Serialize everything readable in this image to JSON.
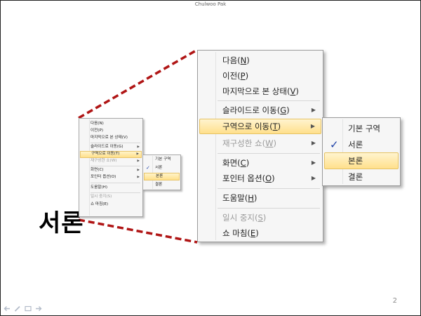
{
  "slide": {
    "title": "Chulwoo Pak",
    "page_number": "2",
    "big_label": "서론"
  },
  "colors": {
    "connector": "#b01515",
    "highlight": "#ffe08a",
    "check": "#1b3fa6"
  },
  "nav_icons": [
    "prev-arrow-icon",
    "pen-icon",
    "menu-icon",
    "next-arrow-icon"
  ],
  "menu": {
    "items": [
      {
        "label": "다음(N)",
        "disabled": false,
        "submenu": false,
        "active": false
      },
      {
        "label": "이전(P)",
        "disabled": false,
        "submenu": false,
        "active": false
      },
      {
        "label": "마지막으로 본 상태(V)",
        "disabled": false,
        "submenu": false,
        "active": false
      },
      {
        "label": "슬라이드로 이동(G)",
        "disabled": false,
        "submenu": true,
        "active": false
      },
      {
        "label": "구역으로 이동(T)",
        "disabled": false,
        "submenu": true,
        "active": true
      },
      {
        "label": "재구성한 쇼(W)",
        "disabled": true,
        "submenu": true,
        "active": false
      },
      {
        "label": "화면(C)",
        "disabled": false,
        "submenu": true,
        "active": false
      },
      {
        "label": "포인터 옵션(O)",
        "disabled": false,
        "submenu": true,
        "active": false
      },
      {
        "label": "도움말(H)",
        "disabled": false,
        "submenu": false,
        "active": false
      },
      {
        "label": "일시 중지(S)",
        "disabled": true,
        "submenu": false,
        "active": false
      },
      {
        "label": "쇼 마침(E)",
        "disabled": false,
        "submenu": false,
        "active": false
      }
    ]
  },
  "submenu": {
    "items": [
      {
        "label": "기본 구역",
        "checked": false,
        "active": false
      },
      {
        "label": "서론",
        "checked": true,
        "active": false
      },
      {
        "label": "본론",
        "checked": false,
        "active": true
      },
      {
        "label": "결론",
        "checked": false,
        "active": false
      }
    ]
  },
  "large_menu_labels": [
    {
      "text": "다음",
      "key": "N"
    },
    {
      "text": "이전",
      "key": "P"
    },
    {
      "text": "마지막으로 본 상태",
      "key": "V"
    },
    {
      "text": "슬라이드로 이동",
      "key": "G"
    },
    {
      "text": "구역으로 이동",
      "key": "T"
    },
    {
      "text": "재구성한 쇼",
      "key": "W"
    },
    {
      "text": "화면",
      "key": "C"
    },
    {
      "text": "포인터 옵션",
      "key": "O"
    },
    {
      "text": "도움말",
      "key": "H"
    },
    {
      "text": "일시 중지",
      "key": "S"
    },
    {
      "text": "쇼 마침",
      "key": "E"
    }
  ],
  "check_glyph": "✓",
  "arrow_glyph": "▶"
}
